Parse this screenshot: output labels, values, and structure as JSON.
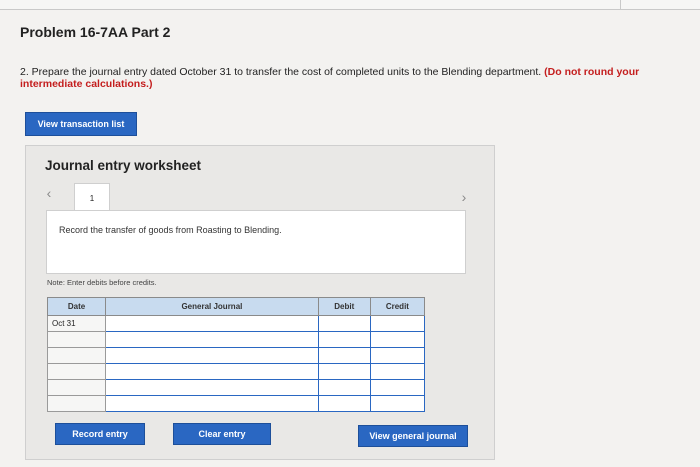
{
  "problem": {
    "title": "Problem 16-7AA Part 2",
    "instruction_main": "2. Prepare the journal entry dated October 31 to transfer the cost of completed units to the Blending department.",
    "instruction_note": "(Do not round your intermediate calculations.)"
  },
  "buttons": {
    "view_transaction_list": "View transaction list",
    "record_entry": "Record entry",
    "clear_entry": "Clear entry",
    "view_general_journal": "View general journal"
  },
  "worksheet": {
    "title": "Journal entry worksheet",
    "tab_number": "1",
    "prev_icon": "‹",
    "next_icon": "›",
    "instruction": "Record the transfer of goods from Roasting to Blending.",
    "note": "Note: Enter debits before credits."
  },
  "journal": {
    "headers": [
      "Date",
      "General Journal",
      "Debit",
      "Credit"
    ],
    "date_first_row": "Oct 31"
  },
  "colors": {
    "primary_button": "#2a67c2",
    "table_header": "#c8dbef",
    "red_note": "#c41e1e"
  }
}
